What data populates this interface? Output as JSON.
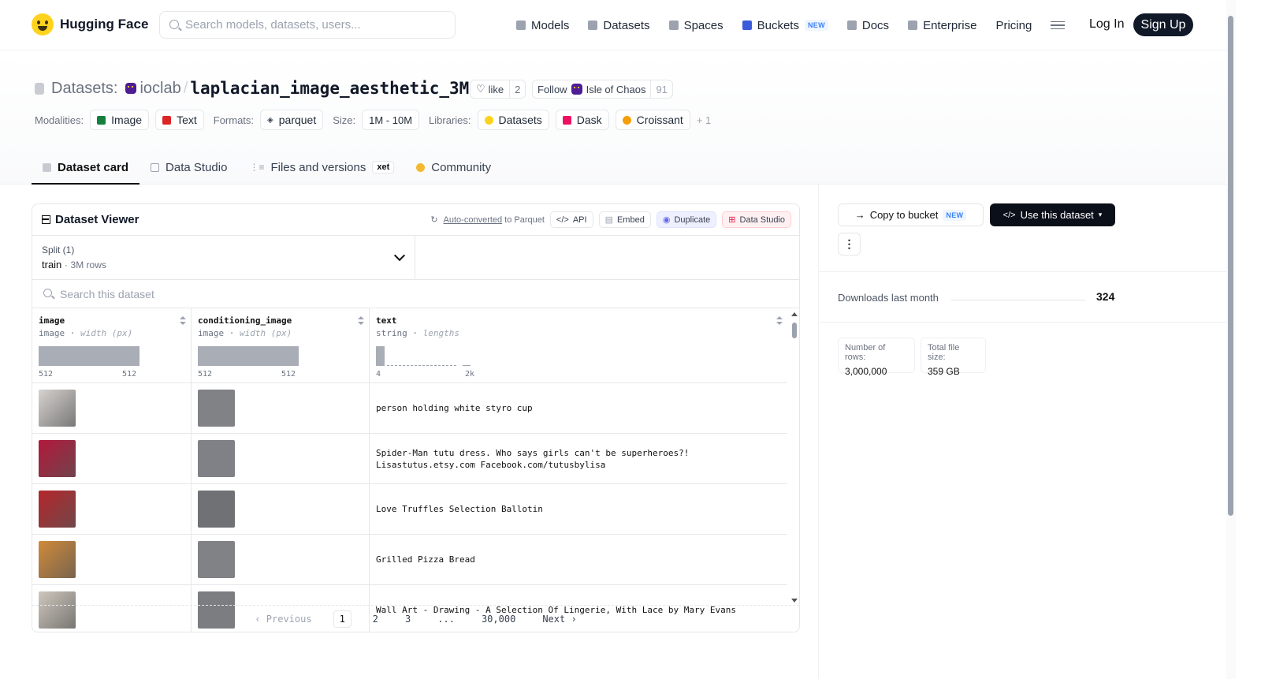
{
  "nav": {
    "brand": "Hugging Face",
    "search_placeholder": "Search models, datasets, users...",
    "links": [
      {
        "label": "Models",
        "icon": "cube-icon"
      },
      {
        "label": "Datasets",
        "icon": "database-icon"
      },
      {
        "label": "Spaces",
        "icon": "grid-icon"
      },
      {
        "label": "Buckets",
        "icon": "bucket-icon",
        "badge": "NEW"
      },
      {
        "label": "Docs",
        "icon": "book-icon"
      },
      {
        "label": "Enterprise",
        "icon": "enterprise-icon"
      },
      {
        "label": "Pricing"
      }
    ],
    "login": "Log In",
    "signup": "Sign Up"
  },
  "header": {
    "section": "Datasets:",
    "org": "ioclab",
    "sep": "/",
    "repo": "laplacian_image_aesthetic_3M",
    "like_label": "like",
    "like_count": "2",
    "follow_label": "Follow",
    "follow_org": "Isle of Chaos",
    "follow_count": "91",
    "modalities_label": "Modalities:",
    "modalities": [
      "Image",
      "Text"
    ],
    "formats_label": "Formats:",
    "formats": [
      "parquet"
    ],
    "size_label": "Size:",
    "size": "1M - 10M",
    "libraries_label": "Libraries:",
    "libraries": [
      "Datasets",
      "Dask",
      "Croissant"
    ],
    "libraries_more": "+ 1"
  },
  "tabs": [
    {
      "label": "Dataset card",
      "active": true
    },
    {
      "label": "Data Studio"
    },
    {
      "label": "Files and versions",
      "badge": "xet"
    },
    {
      "label": "Community"
    }
  ],
  "viewer": {
    "title": "Dataset Viewer",
    "auto_converted": "Auto-converted",
    "auto_converted_suffix": "to Parquet",
    "api": "API",
    "embed": "Embed",
    "duplicate": "Duplicate",
    "data_studio": "Data Studio",
    "split_label": "Split (1)",
    "split_name": "train",
    "split_rows": "3M rows",
    "search_placeholder": "Search this dataset",
    "columns": [
      {
        "name": "image",
        "type": "image",
        "stat": "width (px)",
        "min": "512",
        "max": "512"
      },
      {
        "name": "conditioning_image",
        "type": "image",
        "stat": "width (px)",
        "min": "512",
        "max": "512"
      },
      {
        "name": "text",
        "type": "string",
        "stat": "lengths",
        "min": "4",
        "max": "2k"
      }
    ],
    "rows": [
      {
        "thumb_color": "#d6d2cf",
        "cond_color": "#808286",
        "text": "person holding white styro cup"
      },
      {
        "thumb_color": "#b3183a",
        "cond_color": "#7f8186",
        "text": "Spider-Man tutu dress. Who says girls can't be superheroes?!\nLisastutus.etsy.com Facebook.com/tutusbylisa"
      },
      {
        "thumb_color": "#b5262b",
        "cond_color": "#6f7175",
        "text": "Love Truffles Selection Ballotin"
      },
      {
        "thumb_color": "#d08a3a",
        "cond_color": "#808286",
        "text": "Grilled Pizza Bread"
      },
      {
        "thumb_color": "#cfc7bd",
        "cond_color": "#7b7d81",
        "text": "Wall Art - Drawing - A Selection Of Lingerie, With Lace by Mary Evans"
      }
    ],
    "pager": {
      "previous": "Previous",
      "pages": [
        "1",
        "2",
        "3",
        "...",
        "30,000"
      ],
      "next": "Next"
    }
  },
  "sidebar": {
    "copy_to_bucket": "Copy to bucket",
    "copy_badge": "NEW",
    "use_dataset": "Use this dataset",
    "more": "⋮",
    "downloads_label": "Downloads last month",
    "downloads_value": "324",
    "rows_label": "Number of rows:",
    "rows_value": "3,000,000",
    "size_label": "Total file size:",
    "size_value": "359 GB"
  },
  "colors": {
    "accent_dark": "#0b0f19",
    "hf_yellow": "#ffd21e",
    "duplicate_bg": "#eef0ff",
    "data_studio_bg": "#fff1f2"
  }
}
